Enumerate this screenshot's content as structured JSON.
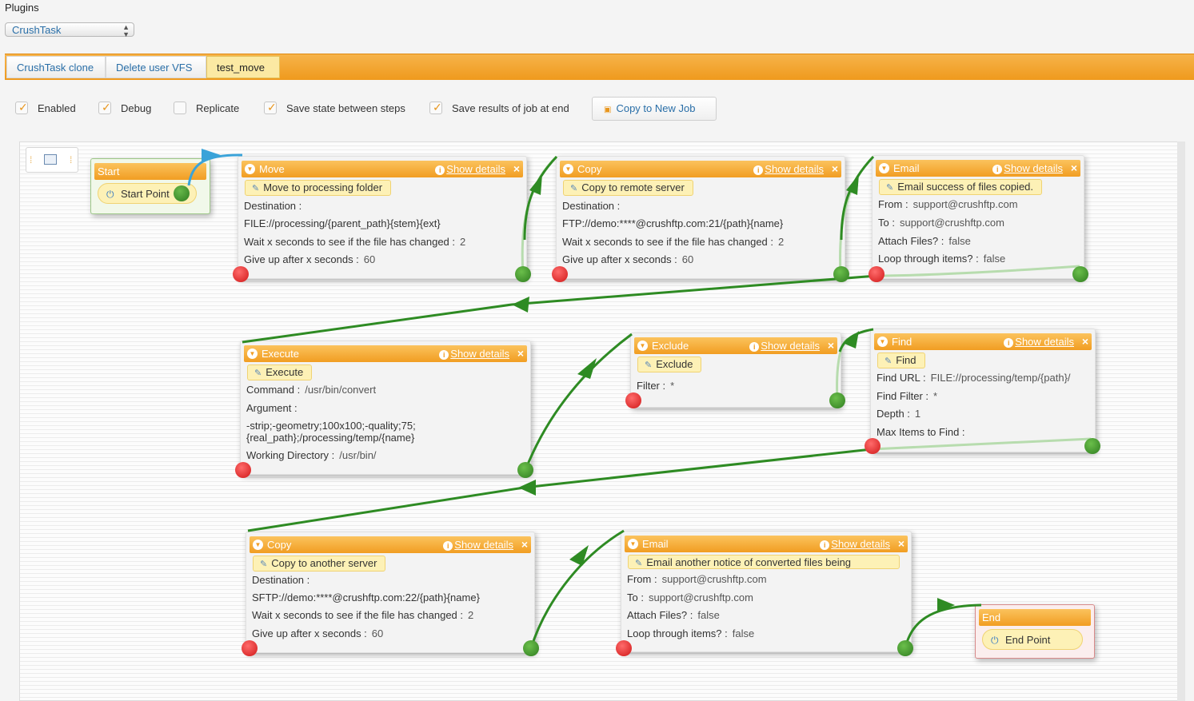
{
  "header": {
    "plugins_label": "Plugins",
    "plugin_select": "CrushTask"
  },
  "tabs": [
    {
      "label": "CrushTask clone"
    },
    {
      "label": "Delete user VFS"
    },
    {
      "label": "test_move"
    }
  ],
  "options": [
    {
      "label": "Enabled",
      "checked": true
    },
    {
      "label": "Debug",
      "checked": true
    },
    {
      "label": "Replicate",
      "checked": false
    },
    {
      "label": "Save state between steps",
      "checked": true
    },
    {
      "label": "Save results of job at end",
      "checked": true
    }
  ],
  "copy_button": "Copy to New Job",
  "common": {
    "show_details": "Show details"
  },
  "start": {
    "title": "Start",
    "point": "Start Point"
  },
  "end": {
    "title": "End",
    "point": "End Point"
  },
  "nodes": {
    "move": {
      "title": "Move",
      "subtitle": "Move to processing folder",
      "destination_label": "Destination :",
      "destination_value": "FILE://processing/{parent_path}{stem}{ext}",
      "wait_label": "Wait x seconds to see if the file has changed :",
      "wait_value": "2",
      "giveup_label": "Give up after x seconds :",
      "giveup_value": "60"
    },
    "copy1": {
      "title": "Copy",
      "subtitle": "Copy to remote server",
      "destination_label": "Destination :",
      "destination_value": "FTP://demo:****@crushftp.com:21/{path}{name}",
      "wait_label": "Wait x seconds to see if the file has changed :",
      "wait_value": "2",
      "giveup_label": "Give up after x seconds :",
      "giveup_value": "60"
    },
    "email1": {
      "title": "Email",
      "subtitle": "Email success of files copied.",
      "from_label": "From :",
      "from_value": "support@crushftp.com",
      "to_label": "To :",
      "to_value": "support@crushftp.com",
      "attach_label": "Attach Files? :",
      "attach_value": "false",
      "loop_label": "Loop through items? :",
      "loop_value": "false"
    },
    "execute": {
      "title": "Execute",
      "subtitle": "Execute",
      "command_label": "Command :",
      "command_value": "/usr/bin/convert",
      "argument_label": "Argument :",
      "argument_line1": "-strip;-geometry;100x100;-quality;75;",
      "argument_line2": "{real_path};/processing/temp/{name}",
      "workdir_label": "Working Directory :",
      "workdir_value": "/usr/bin/"
    },
    "exclude": {
      "title": "Exclude",
      "subtitle": "Exclude",
      "filter_label": "Filter :",
      "filter_value": "*"
    },
    "find": {
      "title": "Find",
      "subtitle": "Find",
      "url_label": "Find URL :",
      "url_value": "FILE://processing/temp/{path}/",
      "filter_label": "Find Filter :",
      "filter_value": "*",
      "depth_label": "Depth :",
      "depth_value": "1",
      "max_label": "Max Items to Find :",
      "max_value": ""
    },
    "copy2": {
      "title": "Copy",
      "subtitle": "Copy to another server",
      "destination_label": "Destination :",
      "destination_value": "SFTP://demo:****@crushftp.com:22/{path}{name}",
      "wait_label": "Wait x seconds to see if the file has changed :",
      "wait_value": "2",
      "giveup_label": "Give up after x seconds :",
      "giveup_value": "60"
    },
    "email2": {
      "title": "Email",
      "subtitle": "Email another notice of converted files being",
      "from_label": "From :",
      "from_value": "support@crushftp.com",
      "to_label": "To :",
      "to_value": "support@crushftp.com",
      "attach_label": "Attach Files? :",
      "attach_value": "false",
      "loop_label": "Loop through items? :",
      "loop_value": "false"
    }
  },
  "colors": {
    "accent_orange": "#f19d22",
    "link_blue": "#2a6fa8",
    "wire_green": "#2e8b23",
    "start_wire_blue": "#3aa3d9"
  }
}
